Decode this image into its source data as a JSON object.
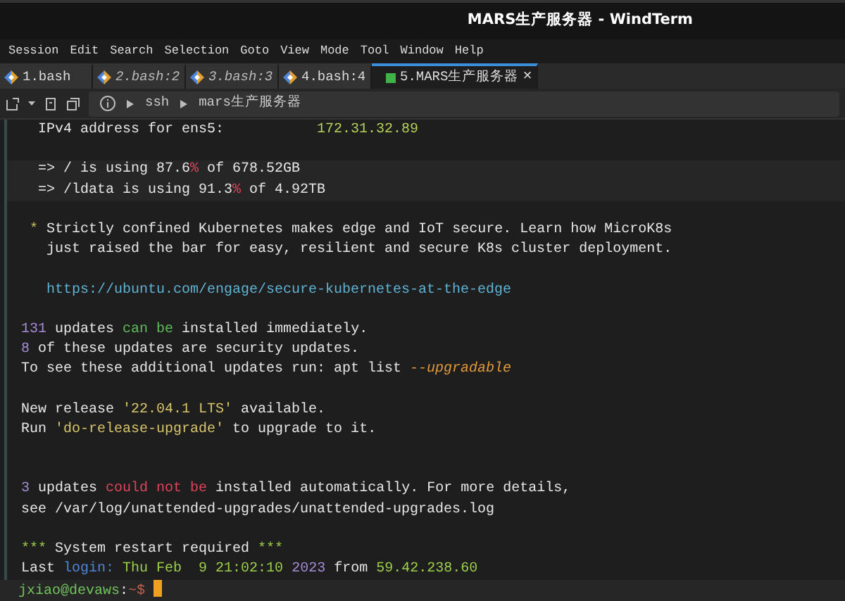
{
  "window": {
    "title": "MARS生产服务器 - WindTerm"
  },
  "menu": [
    "Session",
    "Edit",
    "Search",
    "Selection",
    "Goto",
    "View",
    "Mode",
    "Tool",
    "Window",
    "Help"
  ],
  "tabs": [
    {
      "label": "1.bash",
      "selected": false,
      "italic": false
    },
    {
      "label": "2.bash:2",
      "selected": false,
      "italic": true
    },
    {
      "label": "3.bash:3",
      "selected": false,
      "italic": true
    },
    {
      "label": "4.bash:4",
      "selected": false,
      "italic": false
    },
    {
      "label": "5.MARS生产服务器",
      "selected": true,
      "italic": false,
      "close": "×"
    }
  ],
  "breadcrumb": [
    "ssh",
    "mars生产服务器"
  ],
  "terminal": {
    "blocks": [
      {
        "highlight": false,
        "lines": [
          {
            "segments": [
              {
                "text": "  IPv4 address for ens5:           ",
                "color": "#e6e6e6"
              },
              {
                "text": "172.31.32.89",
                "color": "#b5d15a"
              }
            ]
          }
        ]
      },
      {
        "highlight": true,
        "lines": [
          {
            "segments": [
              {
                "text": "  => / is using 87.6",
                "color": "#e6e6e6"
              },
              {
                "text": "%",
                "color": "#e0445a"
              },
              {
                "text": " of 678.52GB",
                "color": "#e6e6e6"
              }
            ]
          },
          {
            "segments": [
              {
                "text": "  => /ldata is using 91.3",
                "color": "#e6e6e6"
              },
              {
                "text": "%",
                "color": "#e0445a"
              },
              {
                "text": " of 4.92TB",
                "color": "#e6e6e6"
              }
            ]
          }
        ]
      },
      {
        "highlight": false,
        "lines": [
          {
            "segments": [
              {
                "text": " *",
                "color": "#c9c05a"
              },
              {
                "text": " Strictly confined Kubernetes makes edge and IoT secure. Learn how MicroK8s",
                "color": "#e6e6e6"
              }
            ]
          },
          {
            "segments": [
              {
                "text": "   just raised the bar for easy, resilient and secure K8s cluster deployment.",
                "color": "#e6e6e6"
              }
            ]
          }
        ]
      },
      {
        "highlight": false,
        "lines": [
          {
            "segments": [
              {
                "text": "   https://ubuntu.com/engage/secure-kubernetes-at-the-edge",
                "color": "#5fb3d4"
              }
            ]
          }
        ]
      },
      {
        "highlight": false,
        "lines": [
          {
            "segments": [
              {
                "text": "131",
                "color": "#a58bd8"
              },
              {
                "text": " updates ",
                "color": "#e6e6e6"
              },
              {
                "text": "can be",
                "color": "#5fbf5a"
              },
              {
                "text": " installed immediately.",
                "color": "#e6e6e6"
              }
            ]
          },
          {
            "segments": [
              {
                "text": "8",
                "color": "#a58bd8"
              },
              {
                "text": " of these updates are security updates.",
                "color": "#e6e6e6"
              }
            ]
          },
          {
            "segments": [
              {
                "text": "To see these additional updates run: apt list ",
                "color": "#e6e6e6"
              },
              {
                "text": "--upgradable",
                "color": "#e39a3c",
                "italic": true
              }
            ]
          }
        ]
      },
      {
        "highlight": false,
        "lines": [
          {
            "segments": [
              {
                "text": "New release ",
                "color": "#e6e6e6"
              },
              {
                "text": "'22.04.1 LTS'",
                "color": "#d8c46a"
              },
              {
                "text": " available.",
                "color": "#e6e6e6"
              }
            ]
          },
          {
            "segments": [
              {
                "text": "Run ",
                "color": "#e6e6e6"
              },
              {
                "text": "'do-release-upgrade'",
                "color": "#d8c46a"
              },
              {
                "text": " to upgrade to it.",
                "color": "#e6e6e6"
              }
            ]
          }
        ]
      },
      {
        "highlight": false,
        "lines": [
          {
            "kind": "blank"
          },
          {
            "segments": [
              {
                "text": "3",
                "color": "#a58bd8"
              },
              {
                "text": " updates ",
                "color": "#e6e6e6"
              },
              {
                "text": "could not be",
                "color": "#e0445a"
              },
              {
                "text": " installed automatically. For more details,",
                "color": "#e6e6e6"
              }
            ]
          },
          {
            "segments": [
              {
                "text": "see /var/log/unattended-upgrades/unattended-upgrades.log",
                "color": "#e6e6e6"
              }
            ]
          }
        ]
      },
      {
        "highlight": false,
        "lines": [
          {
            "segments": [
              {
                "text": "***",
                "color": "#9ccf4a"
              },
              {
                "text": " System restart required ",
                "color": "#e6e6e6"
              },
              {
                "text": "***",
                "color": "#9ccf4a"
              }
            ]
          },
          {
            "segments": [
              {
                "text": "Last ",
                "color": "#e6e6e6"
              },
              {
                "text": "login:",
                "color": "#4f86d8"
              },
              {
                "text": " Thu Feb  9 21:02:10 ",
                "color": "#9ccf4a"
              },
              {
                "text": "2023",
                "color": "#a58bd8"
              },
              {
                "text": " from ",
                "color": "#e6e6e6"
              },
              {
                "text": "59.42.238.60",
                "color": "#9ccf4a"
              }
            ]
          }
        ]
      }
    ],
    "prompt": [
      {
        "text": "jxiao@devaws",
        "color": "#6fc35a"
      },
      {
        "text": ":",
        "color": "#e6e6e6"
      },
      {
        "text": "~$",
        "color": "#c0604a"
      }
    ]
  }
}
